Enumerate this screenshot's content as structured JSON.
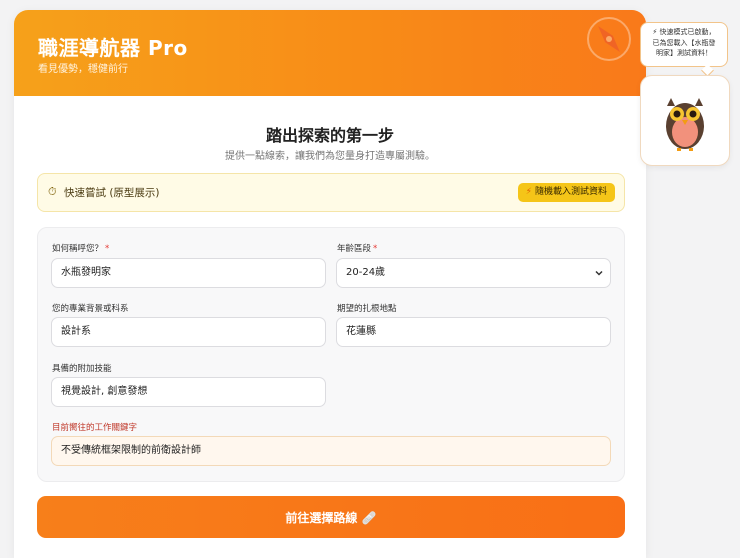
{
  "header": {
    "title": "職涯導航器 Pro",
    "subtitle": "看見優勢，穩健前行"
  },
  "intro": {
    "title": "踏出探索的第一步",
    "subtitle": "提供一點線索，讓我們為您量身打造專屬測驗。"
  },
  "quick": {
    "icon": "⏱",
    "label": "快速嘗試 (原型展示)",
    "button_icon": "⚡",
    "button_label": "隨機載入測試資料"
  },
  "form": {
    "name_label": "如何稱呼您？",
    "name_value": "水瓶發明家",
    "age_label": "年齡區段",
    "age_value": "20-24歲",
    "major_label": "您的專業背景或科系",
    "major_value": "設計系",
    "location_label": "期望的扎根地點",
    "location_value": "花蓮縣",
    "skills_label": "具備的附加技能",
    "skills_value": "視覺設計, 創意發想",
    "keyword_label": "目前嚮往的工作關鍵字",
    "keyword_value": "不受傳統框架限制的前衛設計師",
    "required_mark": "*"
  },
  "cta": {
    "label": "前往選擇路線",
    "icon": "🩹"
  },
  "assistant": {
    "bubble_line1": "⚡ 快速模式已啟動，",
    "bubble_line2": "已為您載入【水瓶發",
    "bubble_line3": "明家】測試資料！"
  },
  "colors": {
    "brand_orange": "#f88c17",
    "cta_orange": "#f77f1a",
    "quick_yellow": "#f5c518",
    "required_red": "#e53935"
  }
}
